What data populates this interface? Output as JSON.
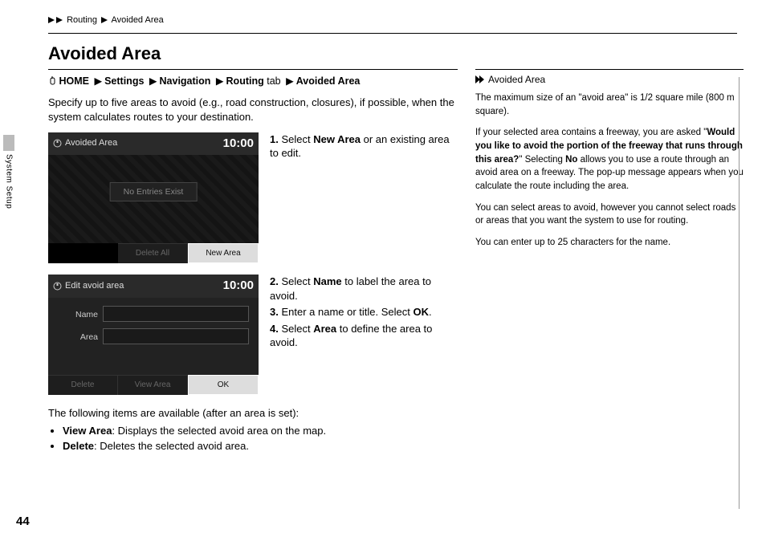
{
  "crumbs": {
    "a": "Routing",
    "b": "Avoided Area"
  },
  "title": "Avoided Area",
  "nav": {
    "home": "HOME",
    "settings": "Settings",
    "navigation": "Navigation",
    "routing": "Routing",
    "tab": " tab",
    "avoided": "Avoided Area"
  },
  "intro": "Specify up to five areas to avoid (e.g., road construction, closures), if possible, when the system calculates routes to your destination.",
  "screen1": {
    "title": "Avoided Area",
    "time": "10:00",
    "empty": "No Entries Exist",
    "delall": "Delete All",
    "newarea": "New Area"
  },
  "step1": {
    "n": "1.",
    "pre": "Select ",
    "bold": "New Area",
    "post": " or an existing area to edit."
  },
  "screen2": {
    "title": "Edit avoid area",
    "time": "10:00",
    "name": "Name",
    "area": "Area",
    "delete": "Delete",
    "view": "View Area",
    "ok": "OK"
  },
  "step2": {
    "n": "2.",
    "pre": "Select ",
    "bold": "Name",
    "post": " to label the area to avoid."
  },
  "step3": {
    "n": "3.",
    "pre": "Enter a name or title. Select ",
    "bold": "OK",
    "post": "."
  },
  "step4": {
    "n": "4.",
    "pre": "Select ",
    "bold": "Area",
    "post": " to define the area to avoid."
  },
  "after": {
    "lead": "The following items are available (after an area is set):",
    "view_b": "View Area",
    "view_t": ": Displays the selected avoid area on the map.",
    "del_b": "Delete",
    "del_t": ": Deletes the selected avoid area."
  },
  "side": {
    "head": "Avoided Area",
    "p1": "The maximum size of an \"avoid area\" is 1/2 square mile (800 m square).",
    "p2a": "If your selected area contains a freeway, you are asked \"",
    "p2b": "Would you like to avoid the portion of the freeway that runs through this area?",
    "p2c": "\" Selecting ",
    "p2d": "No",
    "p2e": " allows you to use a route through an avoid area on a freeway. The pop-up message appears when you calculate the route including the area.",
    "p3": "You can select areas to avoid, however you cannot select roads or areas that you want the system to use for routing.",
    "p4": "You can enter up to 25 characters for the name."
  },
  "sidetab": "System Setup",
  "pagenum": "44"
}
